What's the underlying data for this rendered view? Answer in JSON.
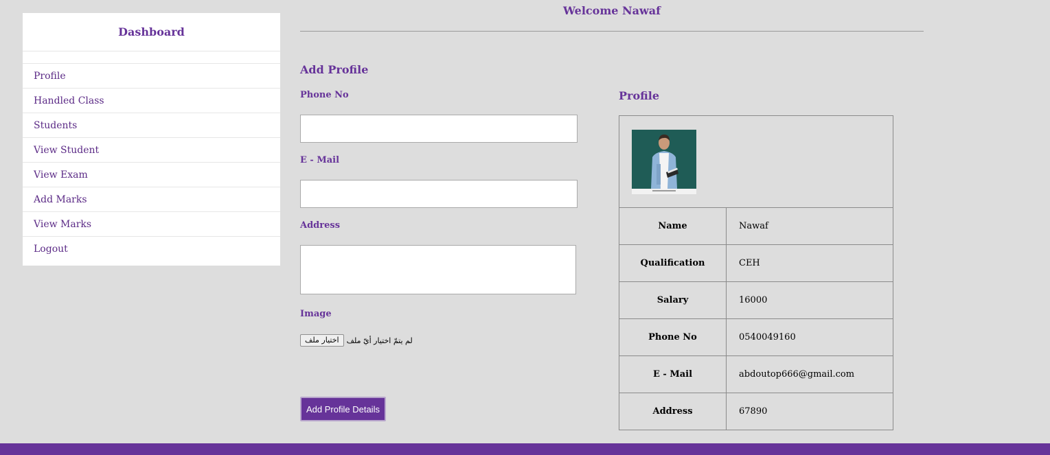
{
  "sidebar": {
    "title": "Dashboard",
    "items": [
      {
        "label": "Profile"
      },
      {
        "label": "Handled Class"
      },
      {
        "label": "Students"
      },
      {
        "label": "View Student"
      },
      {
        "label": "View Exam"
      },
      {
        "label": "Add Marks"
      },
      {
        "label": "View Marks"
      },
      {
        "label": "Logout"
      }
    ]
  },
  "header": {
    "welcome": "Welcome Nawaf"
  },
  "form": {
    "title": "Add Profile",
    "phone_label": "Phone No",
    "phone_value": "",
    "email_label": "E - Mail",
    "email_value": "",
    "address_label": "Address",
    "address_value": "",
    "image_label": "Image",
    "file_button": "اختيار ملف",
    "file_status": "لم يتمّ اختيار أيّ ملف",
    "submit_label": "Add Profile Details"
  },
  "profile": {
    "title": "Profile",
    "photo_icon": "profile-photo",
    "rows": [
      {
        "label": "Name",
        "value": "Nawaf"
      },
      {
        "label": "Qualification",
        "value": "CEH"
      },
      {
        "label": "Salary",
        "value": "16000"
      },
      {
        "label": "Phone No",
        "value": "0540049160"
      },
      {
        "label": "E - Mail",
        "value": "abdoutop666@gmail.com"
      },
      {
        "label": "Address",
        "value": "67890"
      }
    ]
  },
  "colors": {
    "accent": "#663399",
    "background": "#dddddd",
    "panel": "#ffffff"
  }
}
